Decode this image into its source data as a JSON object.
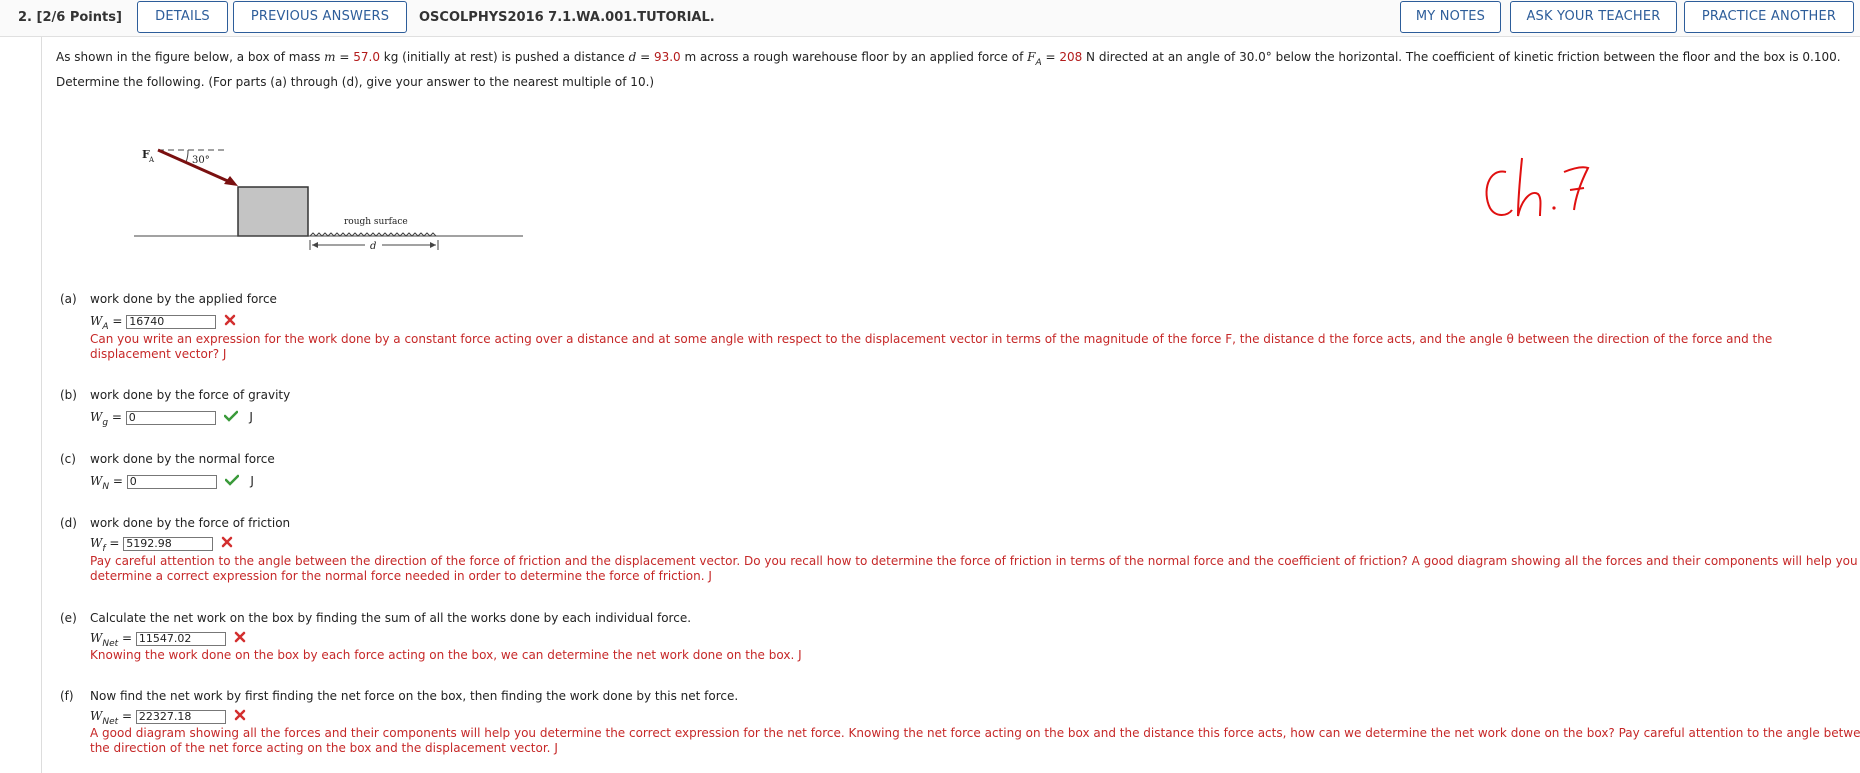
{
  "header": {
    "question_number": "2.",
    "points": "[2/6 Points]",
    "buttons": [
      "DETAILS",
      "PREVIOUS ANSWERS"
    ],
    "title": "OSCOLPHYS2016 7.1.WA.001.TUTORIAL.",
    "right_buttons": [
      "MY NOTES",
      "ASK YOUR TEACHER",
      "PRACTICE ANOTHER"
    ]
  },
  "intro": {
    "line1_a": "As shown in the figure below, a box of mass ",
    "m_symbol": "m",
    "eq": " = ",
    "m_value": "57.0",
    "line1_b": " kg (initially at rest) is pushed a distance ",
    "d_symbol": "d",
    "d_value": "93.0",
    "line1_c": " m across a rough warehouse floor by an applied force of ",
    "F_symbol": "F",
    "F_sub": "A",
    "F_value": "208",
    "line1_d": " N directed at an angle of 30.0° below the horizontal. The coefficient of kinetic friction between the floor and the box is 0.100.",
    "line2": "Determine the following. (For parts (a) through (d), give your answer to the nearest multiple of 10.)"
  },
  "figure": {
    "force_label": "F",
    "force_sub": "A",
    "angle_label": "30°",
    "surface_label": "rough surface",
    "distance_label": "d"
  },
  "handwriting": "ch.7",
  "parts": {
    "a": {
      "label": "(a)",
      "text": "work done by the applied force",
      "var": "W",
      "sub": "A",
      "eq": " = ",
      "value": "16740",
      "status": "incorrect",
      "feedback": "Can you write an expression for the work done by a constant force acting over a distance and at some angle with respect to the displacement vector in terms of the magnitude of the force F, the distance d the force acts, and the angle θ between the direction of the force and the displacement vector? J"
    },
    "b": {
      "label": "(b)",
      "text": "work done by the force of gravity",
      "var": "W",
      "sub": "g",
      "eq": " = ",
      "value": "0",
      "status": "correct",
      "unit": "J"
    },
    "c": {
      "label": "(c)",
      "text": "work done by the normal force",
      "var": "W",
      "sub": "N",
      "eq": " = ",
      "value": "0",
      "status": "correct",
      "unit": "J"
    },
    "d": {
      "label": "(d)",
      "text": "work done by the force of friction",
      "var": "W",
      "sub": "f",
      "eq": " = ",
      "value": "5192.98",
      "status": "incorrect",
      "feedback1": "Pay careful attention to the angle between the direction of the force of friction and the displacement vector. Do you recall how to determine the force of friction in terms of the normal force and the coefficient of friction? A good diagram showing all the forces and their components will help you",
      "feedback2": "determine a correct expression for the normal force needed in order to determine the force of friction. J"
    },
    "e": {
      "label": "(e)",
      "text": "Calculate the net work on the box by finding the sum of all the works done by each individual force.",
      "var": "W",
      "sub": "Net",
      "eq": " = ",
      "value": "11547.02",
      "status": "incorrect",
      "feedback": "Knowing the work done on the box by each force acting on the box, we can determine the net work done on the box. J"
    },
    "f": {
      "label": "(f)",
      "text": "Now find the net work by first finding the net force on the box, then finding the work done by this net force.",
      "var": "W",
      "sub": "Net",
      "eq": " = ",
      "value": "22327.18",
      "status": "incorrect",
      "feedback1": "A good diagram showing all the forces and their components will help you determine the correct expression for the net force. Knowing the net force acting on the box and the distance this force acts, how can we determine the net work done on the box? Pay careful attention to the angle between",
      "feedback2": "the direction of the net force acting on the box and the displacement vector. J"
    }
  },
  "colors": {
    "accent": "#2d5d9a",
    "error": "#c62828",
    "given_value": "#b31b1b",
    "correct": "#3a9a3a"
  }
}
